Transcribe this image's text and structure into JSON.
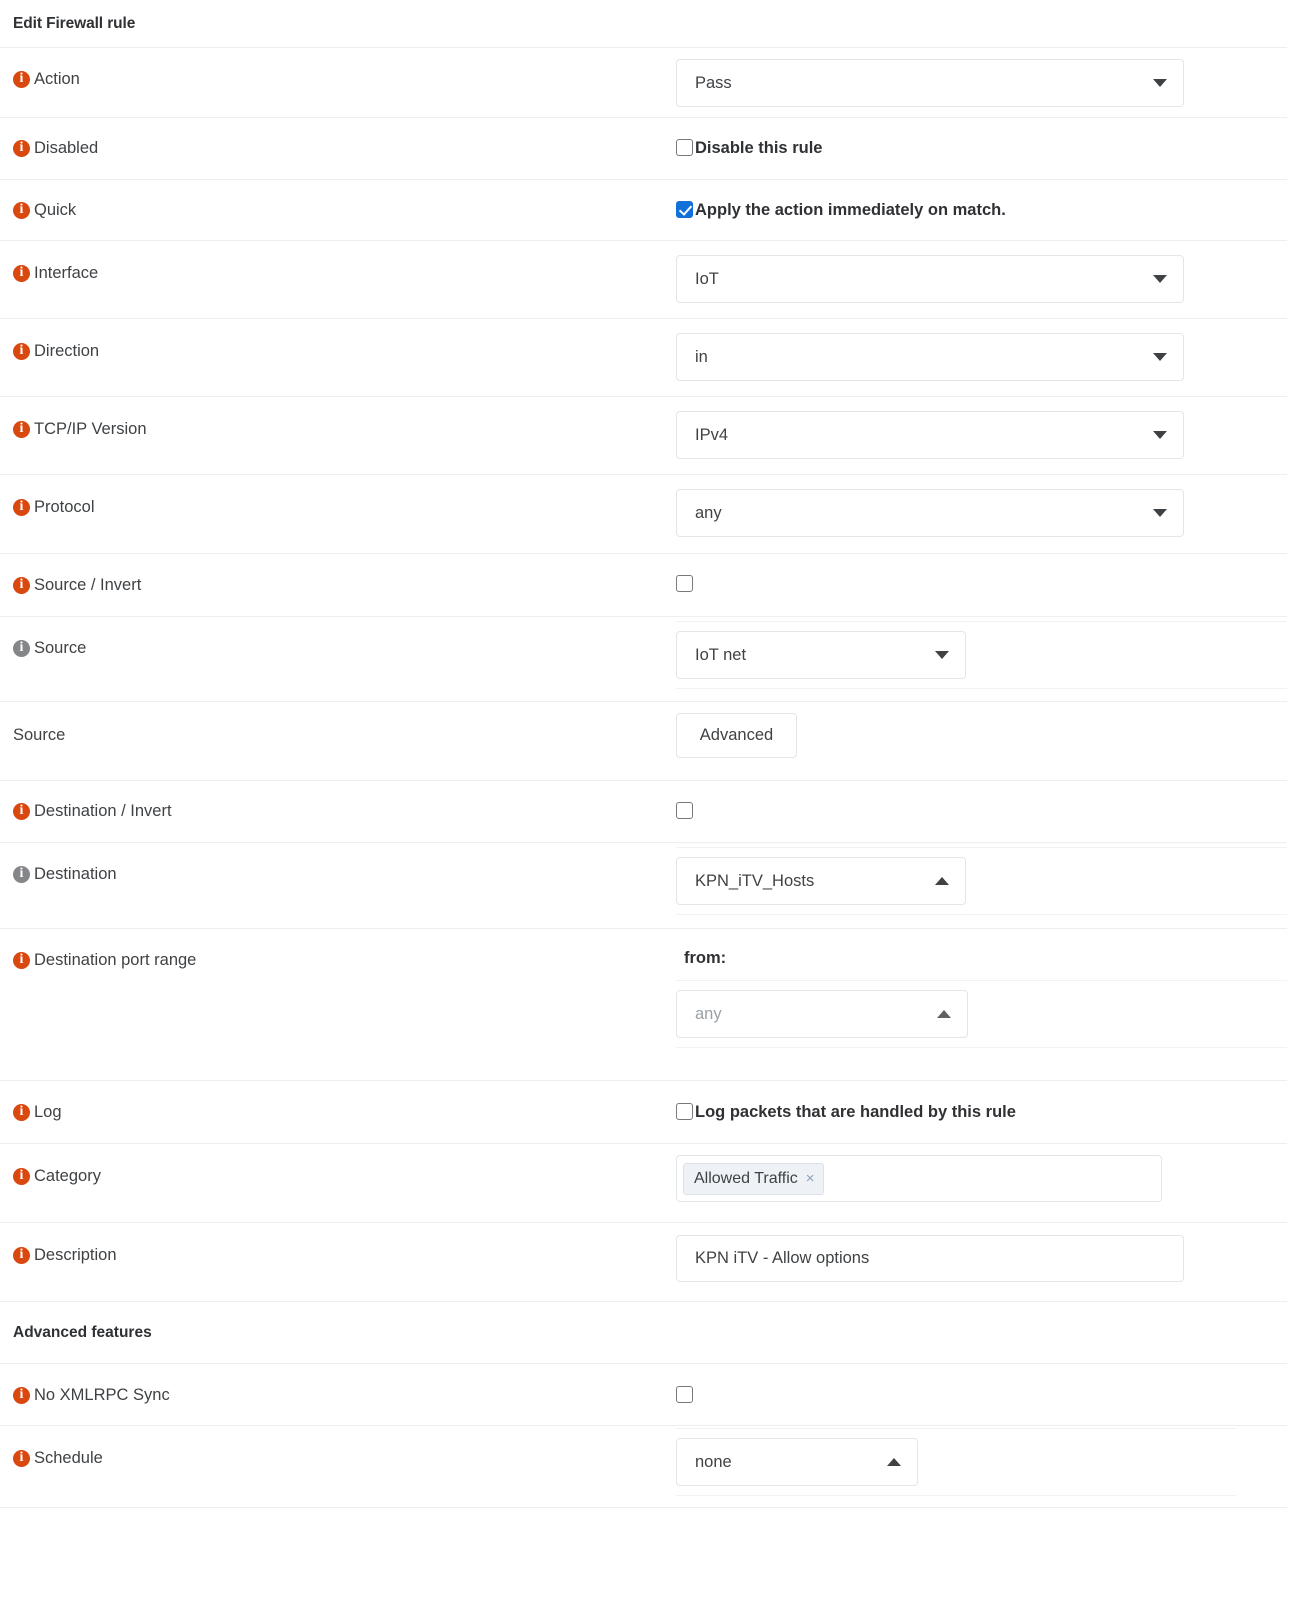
{
  "header": {
    "title": "Edit Firewall rule"
  },
  "rows": {
    "action": {
      "label": "Action",
      "value": "Pass"
    },
    "disabled": {
      "label": "Disabled",
      "checkbox_label": "Disable this rule"
    },
    "quick": {
      "label": "Quick",
      "checkbox_label": "Apply the action immediately on match."
    },
    "interface": {
      "label": "Interface",
      "value": "IoT"
    },
    "direction": {
      "label": "Direction",
      "value": "in"
    },
    "tcpip": {
      "label": "TCP/IP Version",
      "value": "IPv4"
    },
    "protocol": {
      "label": "Protocol",
      "value": "any"
    },
    "source_invert": {
      "label": "Source / Invert"
    },
    "source": {
      "label": "Source",
      "value": "IoT net"
    },
    "source_adv": {
      "label": "Source",
      "button": "Advanced"
    },
    "dest_invert": {
      "label": "Destination / Invert"
    },
    "destination": {
      "label": "Destination",
      "value": "KPN_iTV_Hosts"
    },
    "dest_port": {
      "label": "Destination port range",
      "from_label": "from:",
      "from_value": "any"
    },
    "log": {
      "label": "Log",
      "checkbox_label": "Log packets that are handled by this rule"
    },
    "category": {
      "label": "Category",
      "tags": [
        "Allowed Traffic"
      ],
      "remove_glyph": "×"
    },
    "description": {
      "label": "Description",
      "value": "KPN iTV - Allow options",
      "placeholder": ""
    },
    "advanced_header": {
      "label": "Advanced features"
    },
    "no_xmlrpc": {
      "label": "No XMLRPC Sync"
    },
    "schedule": {
      "label": "Schedule",
      "value": "none"
    }
  },
  "colors": {
    "info_orange": "#d9480f",
    "info_gray": "#84868a",
    "checkbox_checked": "#1171d8",
    "text": "#3f4245",
    "divider": "#eceef0"
  }
}
